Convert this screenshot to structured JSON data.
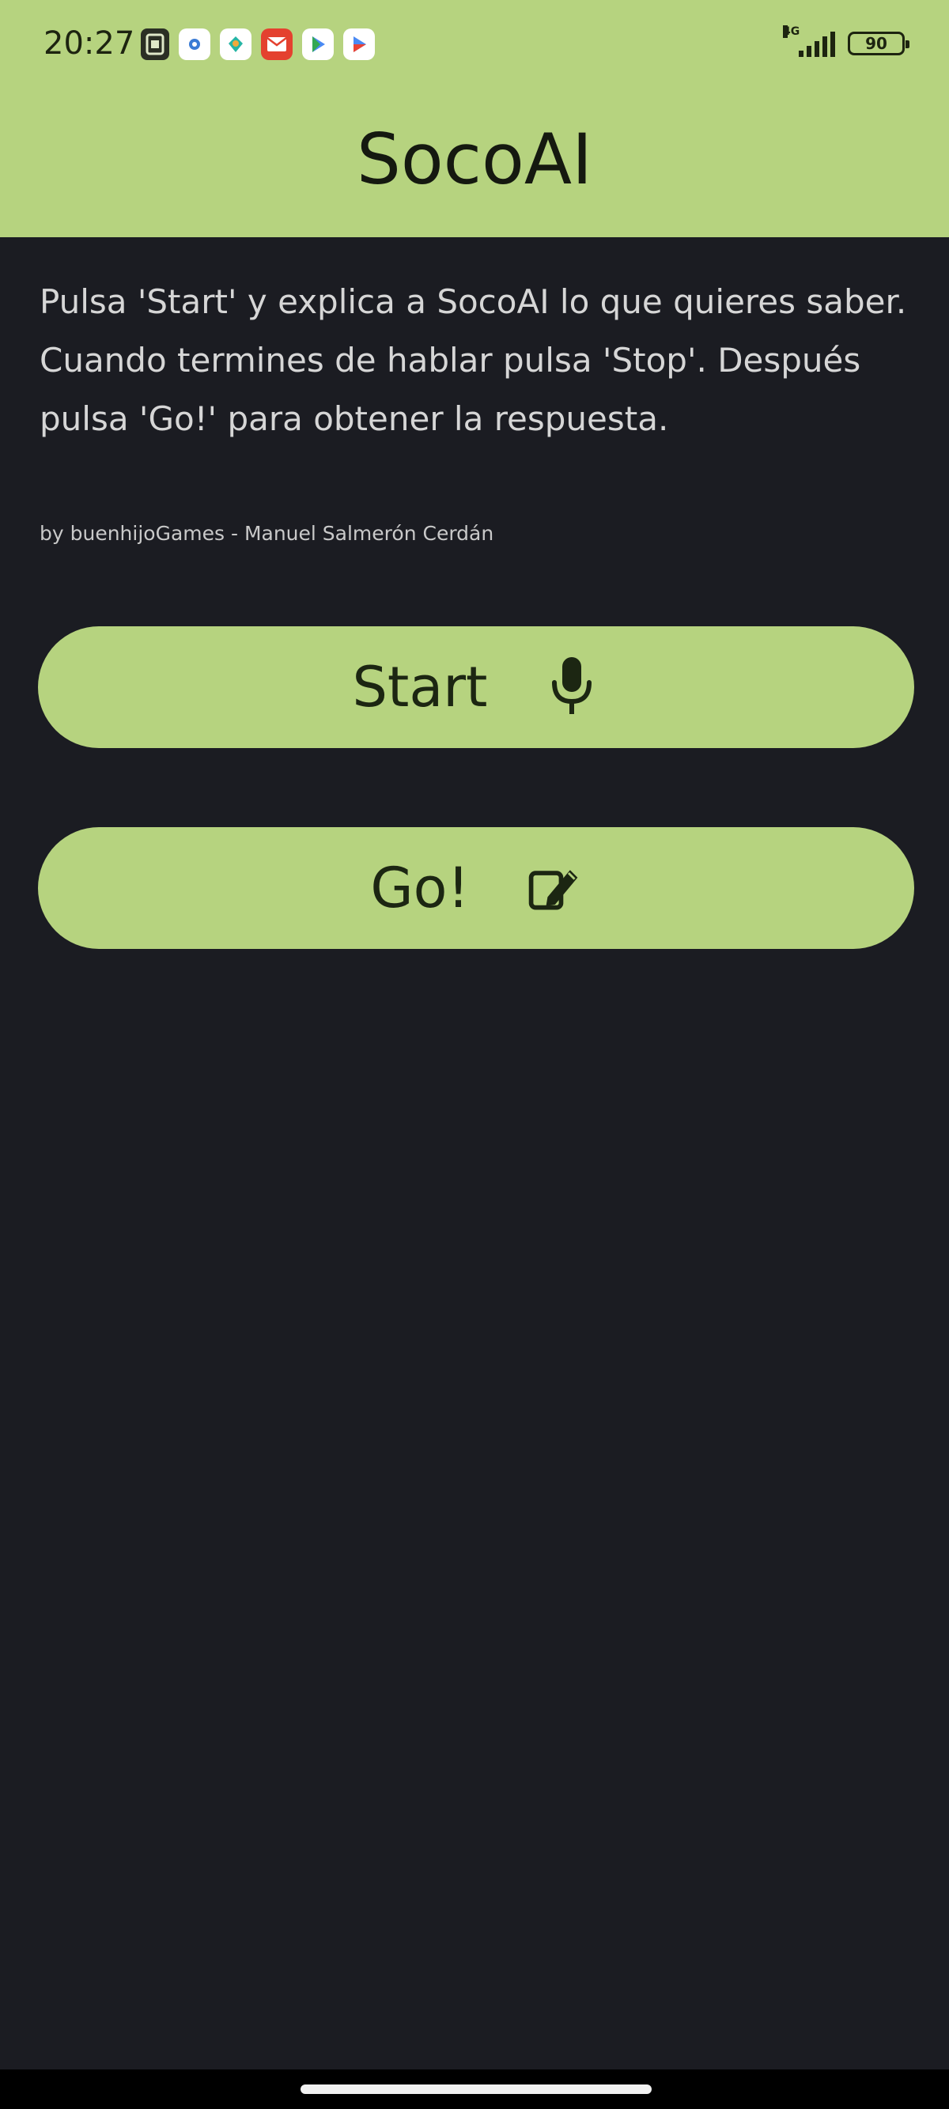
{
  "status_bar": {
    "time": "20:27",
    "network": "4G",
    "battery": "90",
    "notification_icons": [
      "sim-icon",
      "app-icon",
      "app-icon",
      "mail-icon",
      "play-icon",
      "play-icon"
    ]
  },
  "header": {
    "title": "SocoAI"
  },
  "main": {
    "instructions": "Pulsa 'Start' y explica a SocoAI lo que quieres saber. Cuando termines de hablar pulsa 'Stop'. Después pulsa 'Go!' para obtener la respuesta.",
    "credit": "by buenhijoGames - Manuel Salmerón Cerdán",
    "start_button": {
      "label": "Start",
      "icon": "microphone-icon"
    },
    "go_button": {
      "label": "Go!",
      "icon": "edit-pencil-icon"
    }
  },
  "colors": {
    "accent": "#b6d37f",
    "background": "#1b1c22",
    "button_text": "#1c2612",
    "body_text": "#d6d6d6"
  }
}
